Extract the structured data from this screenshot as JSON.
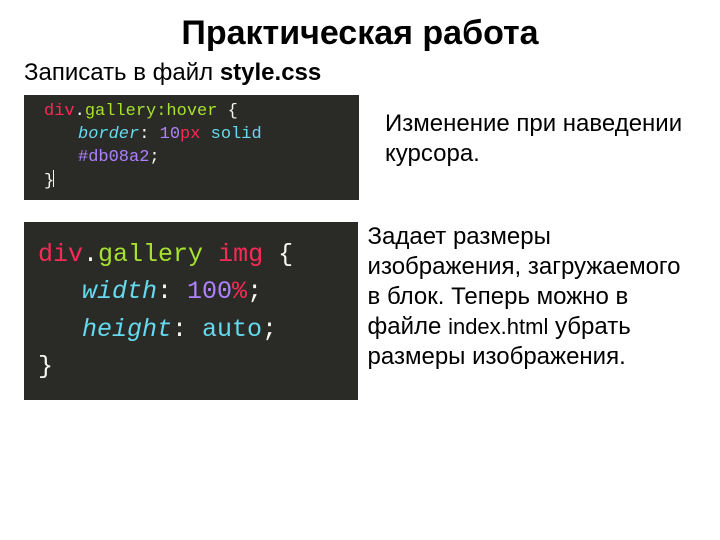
{
  "title": "Практическая работа",
  "subtitle_text": "Записать в файл ",
  "subtitle_filename": "style.css",
  "code1": {
    "sel": "div",
    "dot": ".",
    "class": "gallery",
    "pseudo": ":hover",
    "brace_open": " {",
    "prop": "border",
    "colon": ": ",
    "val_num": "10",
    "val_unit": "px",
    "val_kw": " solid ",
    "val_hex": "#db08a2",
    "semi": ";",
    "brace_close": "}"
  },
  "explain1": "Изменение при наведении курсора.",
  "code2": {
    "sel": "div",
    "dot": ".",
    "class": "gallery",
    "child": " img",
    "brace_open": " {",
    "prop_w": "width",
    "val_w_num": "100",
    "val_w_unit": "%",
    "prop_h": "height",
    "val_h": "auto",
    "colon": ": ",
    "semi": ";",
    "brace_close": "}"
  },
  "explain2_a": "Задает размеры изображения, загружаемого в блок. Теперь можно в файле ",
  "explain2_mono": "index.html",
  "explain2_b": " убрать размеры изображения."
}
